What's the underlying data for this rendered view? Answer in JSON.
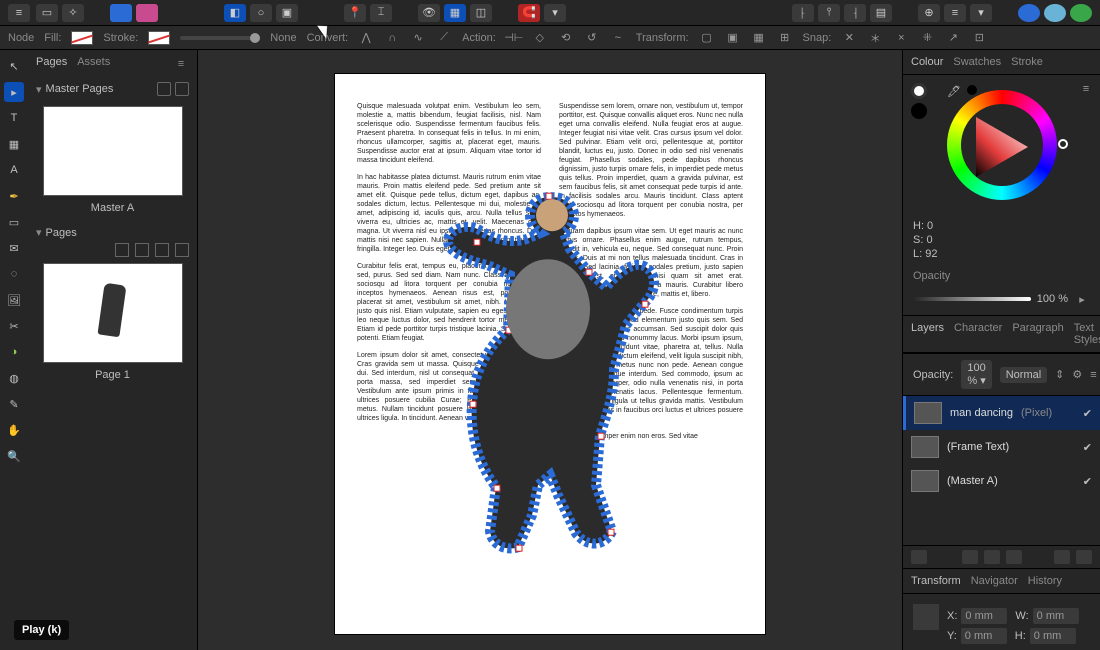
{
  "toolbar2": {
    "node": "Node",
    "fill": "Fill:",
    "stroke": "Stroke:",
    "none": "None",
    "convert": "Convert:",
    "action": "Action:",
    "transform": "Transform:",
    "snap": "Snap:"
  },
  "leftPanel": {
    "tabs": [
      "Pages",
      "Assets"
    ],
    "masterSection": "Master Pages",
    "masterLabel": "Master A",
    "pagesSection": "Pages",
    "pageLabel": "Page 1"
  },
  "tooltip": "Play (k)",
  "colour": {
    "tabs": [
      "Colour",
      "Swatches",
      "Stroke"
    ],
    "h": "H: 0",
    "s": "S: 0",
    "l": "L: 92",
    "opacityLabel": "Opacity",
    "opacityValue": "100 %"
  },
  "layersPanel": {
    "tabs": [
      "Layers",
      "Character",
      "Paragraph",
      "Text Styles"
    ],
    "opacityLabel": "Opacity:",
    "opacityValue": "100 %",
    "blend": "Normal",
    "layers": [
      {
        "name": "man dancing",
        "type": "(Pixel)",
        "checked": true,
        "selected": true
      },
      {
        "name": "(Frame Text)",
        "type": "",
        "checked": true,
        "selected": false
      },
      {
        "name": "(Master A)",
        "type": "",
        "checked": true,
        "selected": false
      }
    ]
  },
  "transform": {
    "tabs": [
      "Transform",
      "Navigator",
      "History"
    ],
    "x": {
      "label": "X:",
      "value": "0 mm"
    },
    "y": {
      "label": "Y:",
      "value": "0 mm"
    },
    "w": {
      "label": "W:",
      "value": "0 mm"
    },
    "h": {
      "label": "H:",
      "value": "0 mm"
    }
  },
  "document": {
    "paragraphs": [
      "Quisque malesuada volutpat enim. Vestibulum leo sem, molestie a, mattis bibendum, feugiat facilisis, nisl. Nam scelerisque odio. Suspendisse fermentum faucibus felis. Praesent pharetra. In consequat felis in tellus. In mi enim, rhoncus ullamcorper, sagittis at, placerat eget, mauris. Suspendisse auctor erat at ipsum. Aliquam vitae tortor id massa tincidunt eleifend.",
      "In hac habitasse platea dictumst. Mauris rutrum enim vitae mauris. Proin mattis eleifend pede. Sed pretium ante sit amet elit. Quisque pede tellus, dictum eget, dapibus ac, sodales dictum, lectus. Pellentesque mi dui, molestie sit amet, adipiscing id, iaculis quis, arcu. Nulla tellus sem, viverra eu, ultricies ac, mattis et, velit. Maecenas quis magna. Ut viverra nisl eu ipsum. Maecenas rhoncus. Duis mattis nisi nec sapien. Nullam eu ante non enim tincidunt fringilla. Integer leo. Duis eget enim.",
      "Curabitur felis erat, tempus eu, placerat et, pellentesque sed, purus. Sed sed diam. Nam nunc. Class aptent taciti sociosqu ad litora torquent per conubia nostra, per inceptos hymenaeos. Aenean risus est, porttitor vel, placerat sit amet, vestibulum sit amet, nibh. Ut faucibus justo quis nisl. Etiam vulputate, sapien eu egestas rutrum, leo neque luctus dolor, sed hendrerit tortor metus ut dui. Etiam id pede porttitor turpis tristique lacinia. Suspendisse potenti. Etiam feugiat.",
      "Lorem ipsum dolor sit amet, consectetuer adipiscing elit. Cras gravida sem ut massa. Quisque accumsan porttitor dui. Sed interdum, nisl ut consequat tristique, lacus nulla porta massa, sed imperdiet sem nunc vitae eros. Vestibulum ante ipsum primis in faucibus orci luctus et ultrices posuere cubilia Curae; Pellentesque sit amet metus. Nullam tincidunt posuere ligula. Aenean volutpat ultrices ligula. In tincidunt. Aenean viverra suscipit tellus.",
      "Suspendisse sem lorem, ornare non, vestibulum ut, tempor porttitor, est. Quisque convallis aliquet eros. Nunc nec nulla eget urna convallis eleifend. Nulla feugiat eros at augue. Integer feugiat nisi vitae velit. Cras cursus ipsum vel dolor. Sed pulvinar. Etiam velit orci, pellentesque at, porttitor blandit, luctus eu, justo. Donec in odio sed nisl venenatis feugiat. Phasellus sodales, pede dapibus rhoncus dignissim, justo turpis ornare felis, in imperdiet pede metus quis tellus. Proin imperdiet, quam a gravida pulvinar, est sem faucibus felis, sit amet consequat pede turpis id ante. In facilisis sodales arcu. Mauris tincidunt. Class aptent taciti sociosqu ad litora torquent per conubia nostra, per inceptos hymenaeos.",
      "Aliquam dapibus ipsum vitae sem. Ut eget mauris ac nunc luctus ornare. Phasellus enim augue, rutrum tempus, blandit in, vehicula eu, neque. Sed consequat nunc. Proin metus. Duis at mi non tellus malesuada tincidunt. Cras in neque. Sed lacinia, felis ut sodales pretium, justo sapien hendrerit est, et convallis nisi quam sit amet erat. Suspendisse consequat nibh a mauris. Curabitur libero ligula, faucibus at, mollis ornare, mattis et, libero.",
      "Aliquam pulvinar congue pede. Fusce condimentum turpis vel dolor. Ut blandit. Sed elementum justo quis sem. Sed eu orci eu ante iaculis accumsan. Sed suscipit dolor quis mi. Curabitur ultrices nonummy lacus. Morbi ipsum ipsum, adipiscing eget, tincidunt vitae, pharetra at, tellus. Nulla gravida, arcu eget dictum eleifend, velit ligula suscipit nibh, sagittis imperdiet metus nunc non pede. Aenean congue pede in nisi tristique interdum. Sed commodo, ipsum ac dignissim ullamcorper, odio nulla venenatis nisi, in porta dolor neque venenatis lacus. Pellentesque fermentum. Mauris sit amet ligula ut tellus gravida mattis. Vestibulum ante ipsum primis in faucibus orci luctus et ultrices posuere cubilia Curae;",
      "Vestibulum semper enim non eros. Sed vitae"
    ]
  }
}
